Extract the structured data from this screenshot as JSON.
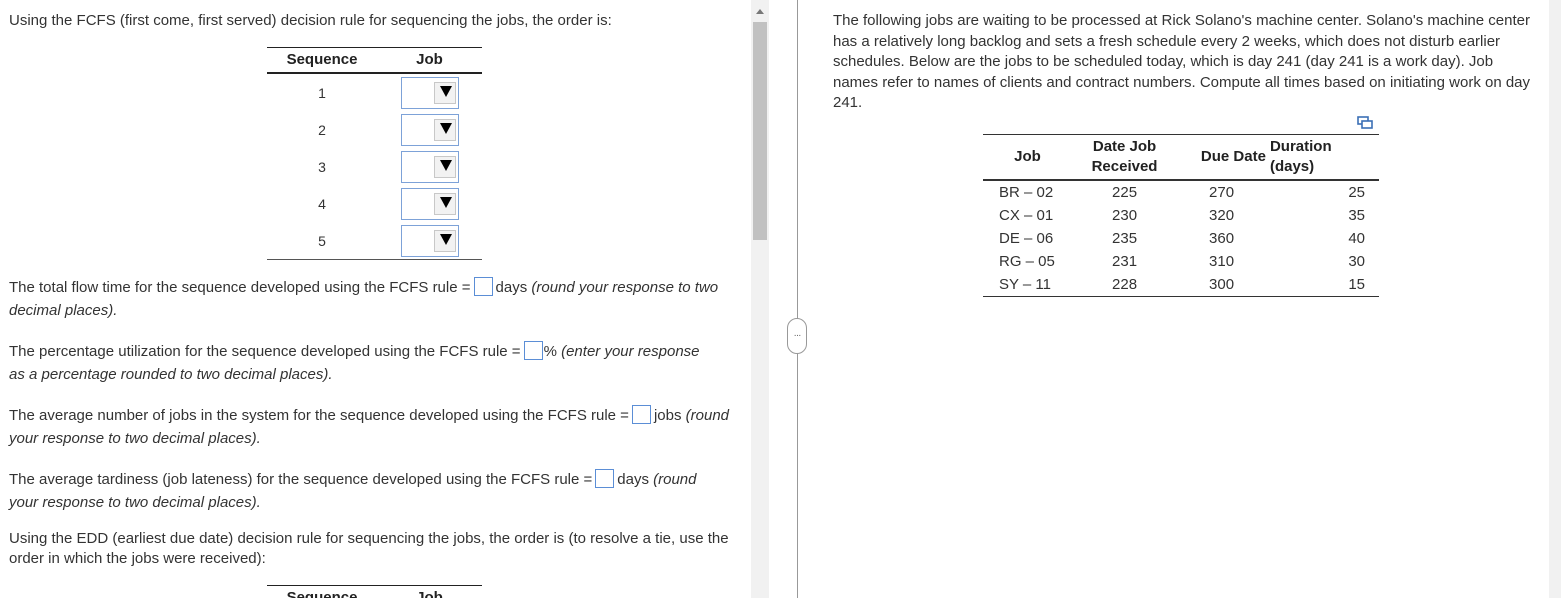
{
  "fcfs_intro": "Using the FCFS (first come, first served) decision rule for sequencing the jobs, the order is:",
  "seq_table": {
    "col_sequence": "Sequence",
    "col_job": "Job",
    "rows": [
      "1",
      "2",
      "3",
      "4",
      "5"
    ]
  },
  "q_flow": {
    "pre": "The total flow time for the sequence developed using the FCFS rule =",
    "unit": "days",
    "note": "(round your response to two decimal places)."
  },
  "q_util": {
    "pre": "The percentage utilization for the sequence developed using the FCFS rule =",
    "unit": "%",
    "note": "(enter your response as a percentage rounded to two decimal places)."
  },
  "q_avgjobs": {
    "pre": "The average number of jobs in the system for the sequence developed using the FCFS rule =",
    "unit": "jobs",
    "note": "(round your response to two decimal places)."
  },
  "q_tardy": {
    "pre": "The average tardiness (job lateness) for the sequence developed using the FCFS rule =",
    "unit": "days",
    "note": "(round your response to two decimal places)."
  },
  "edd_intro": "Using the EDD (earliest due date) decision rule for sequencing the jobs, the order is (to resolve a tie, use the order in which the jobs were received):",
  "problem_text": "The following jobs are waiting to be processed at Rick Solano's machine center. Solano's machine center has a relatively long backlog and sets a fresh schedule every 2 weeks, which does not disturb earlier schedules. Below are the jobs to be scheduled today, which is day 241 (day 241 is a work day). Job names refer to names of clients and contract numbers. Compute all times based on initiating work on day 241.",
  "jobs_table": {
    "headers": {
      "job": "Job",
      "received": "Date Job Received",
      "due": "Due Date",
      "duration": "Duration (days)"
    },
    "rows": [
      {
        "job": "BR – 02",
        "received": "225",
        "due": "270",
        "duration": "25"
      },
      {
        "job": "CX – 01",
        "received": "230",
        "due": "320",
        "duration": "35"
      },
      {
        "job": "DE – 06",
        "received": "235",
        "due": "360",
        "duration": "40"
      },
      {
        "job": "RG – 05",
        "received": "231",
        "due": "310",
        "duration": "30"
      },
      {
        "job": "SY – 11",
        "received": "228",
        "due": "300",
        "duration": "15"
      }
    ]
  },
  "icons": {
    "copy": "copy-icon",
    "dropdown": "triangle-down-icon"
  }
}
